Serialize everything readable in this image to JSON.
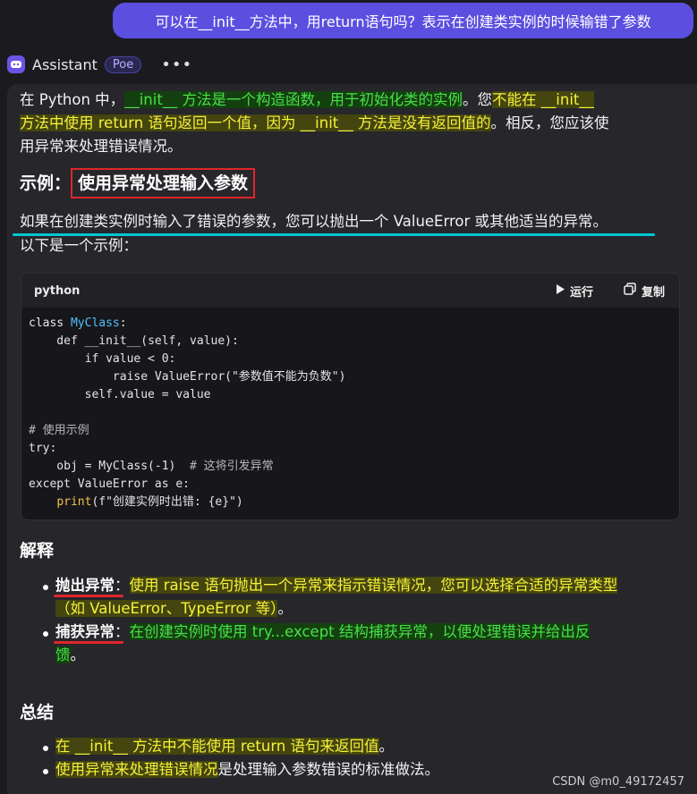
{
  "user_message": "可以在__init__方法中，用return语句吗？表示在创建类实例的时候输错了参数",
  "assistant": {
    "name": "Assistant",
    "badge": "Poe",
    "more": "•••"
  },
  "intro": {
    "line1_a": "在 Python 中，",
    "line1_b": "__init__ 方法是一个构造函数，用于初始化类的实例",
    "line1_c": "。您",
    "line1_d": "不能在 __init__",
    "line2_a": "方法中使用 return 语句返回一个值，因为 __init__ 方法是没有返回值的",
    "line2_b": "。相反，您应该使",
    "line3": "用异常来处理错误情况。"
  },
  "example": {
    "heading_prefix": "示例：",
    "heading_boxed": "使用异常处理输入参数",
    "line1": "如果在创建类实例时输入了错误的参数，您可以抛出一个 ValueError 或其他适当的异常。",
    "line2": "以下是一个示例："
  },
  "code": {
    "language": "python",
    "run_label": "运行",
    "copy_label": "复制",
    "lines": [
      "class MyClass:",
      "    def __init__(self, value):",
      "        if value < 0:",
      "            raise ValueError(\"参数值不能为负数\")",
      "        self.value = value",
      "",
      "# 使用示例",
      "try:",
      "    obj = MyClass(-1)  # 这将引发异常",
      "except ValueError as e:",
      "    print(f\"创建实例时出错: {e}\")"
    ]
  },
  "explain": {
    "heading": "解释",
    "item1_label": "抛出异常",
    "item1_colon": "：",
    "item1_text_a": "使用 raise 语句抛出一个异常来指示错误情况，您可以选择合适的异常类型",
    "item1_text_b": "（如 ValueError、TypeError 等）",
    "item1_text_c": "。",
    "item2_label": "捕获异常",
    "item2_colon": "：",
    "item2_text_a": "在创建实例时使用 try...except 结构捕获异常，以便处理错误并给出反",
    "item2_text_b": "馈",
    "item2_text_c": "。"
  },
  "summary": {
    "heading": "总结",
    "item1_hl": "在 __init__ 方法中不能使用 return 语句来返回值",
    "item1_end": "。",
    "item2_hl": "使用异常来处理错误情况",
    "item2_end": "是处理输入参数错误的标准做法。"
  },
  "watermark": "CSDN @m0_49172457"
}
